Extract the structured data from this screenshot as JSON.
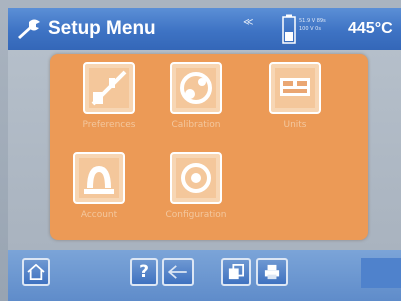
{
  "header": {
    "title": "Setup Menu",
    "signal_icon": "≪",
    "battery_line1": "51.9 V 89s",
    "battery_line2": "100 V 0s",
    "temperature": "445°C"
  },
  "menu": {
    "items": [
      {
        "label": "Preferences",
        "icon": "sliders-icon"
      },
      {
        "label": "Calibration",
        "icon": "calibration-icon"
      },
      {
        "label": "Units",
        "icon": "units-icon"
      },
      {
        "label": "Account",
        "icon": "user-icon"
      },
      {
        "label": "Configuration",
        "icon": "settings-icon"
      }
    ]
  },
  "toolbar": {
    "buttons": [
      "home-icon",
      "help-icon",
      "back-icon",
      "copy-icon",
      "print-icon"
    ],
    "help_label": "?"
  },
  "colors": {
    "title_blue": "#3e73c4",
    "panel_orange": "#ec9a56",
    "background_grey": "#a9b3bf"
  }
}
